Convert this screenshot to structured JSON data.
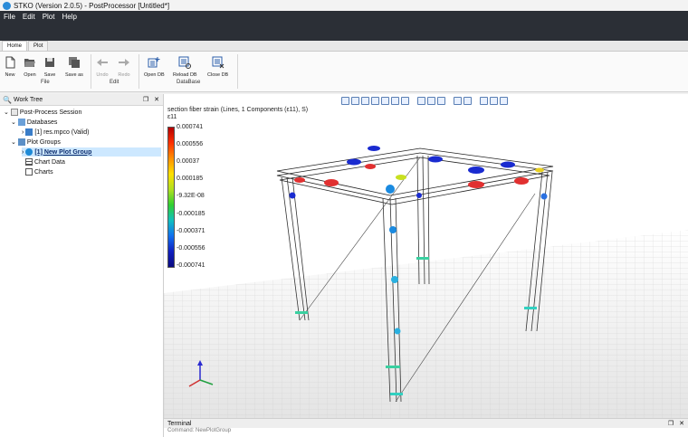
{
  "window": {
    "title": "STKO (Version 2.0.5) - PostProcessor [Untitled*]"
  },
  "menu": {
    "items": [
      "File",
      "Edit",
      "Plot",
      "Help"
    ]
  },
  "tabs": [
    {
      "label": "Home",
      "active": true
    },
    {
      "label": "Plot",
      "active": false
    }
  ],
  "ribbon": {
    "file": {
      "new": "New",
      "open": "Open",
      "save": "Save",
      "save_as": "Save as",
      "group": "File"
    },
    "edit": {
      "undo": "Undo",
      "redo": "Redo",
      "group": "Edit"
    },
    "database": {
      "open_db": "Open DB",
      "reload_db": "Reload DB",
      "close_db": "Close DB",
      "group": "DataBase"
    }
  },
  "worktree": {
    "title": "Work Tree",
    "session": "Post-Process Session",
    "databases": "Databases",
    "db_item": "[1] res.mpco (Valid)",
    "plot_groups": "Plot Groups",
    "plot_group_item": "[1] New Plot Group",
    "chart_data": "Chart Data",
    "charts": "Charts"
  },
  "viewport": {
    "title": "section fiber strain (Lines, 1 Components (ε11), S)",
    "component": "ε11",
    "colorbar_labels": [
      "0.000741",
      "0.000556",
      "0.00037",
      "0.000185",
      "-9.32E-08",
      "-0.000185",
      "-0.000371",
      "-0.000556",
      "-0.000741"
    ]
  },
  "terminal": {
    "title": "Terminal",
    "line": "Command: NewPlotGroup"
  },
  "colors": {
    "menubar": "#2b2f36",
    "accent": "#2a8bd8",
    "selection": "#cde8ff"
  }
}
